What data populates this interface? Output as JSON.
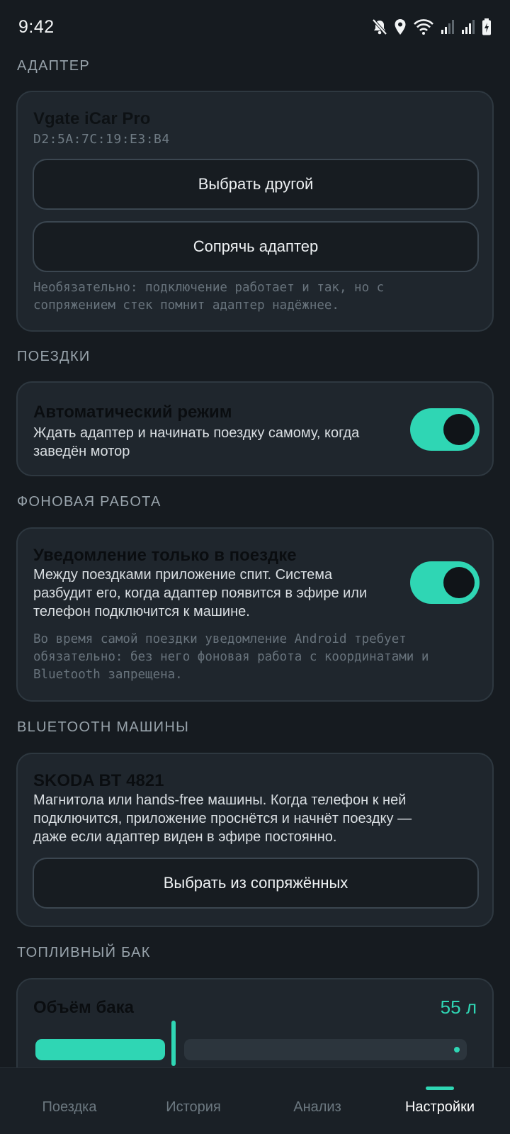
{
  "status_bar": {
    "time": "9:42",
    "icons": [
      "mute-icon",
      "location-icon",
      "wifi-icon",
      "signal-icon",
      "signal-icon",
      "battery-charging-icon"
    ]
  },
  "colors": {
    "accent": "#2fd6b4",
    "background": "#161b20",
    "card": "#1f262d"
  },
  "adapter": {
    "section_title": "АДАПТЕР",
    "name": "Vgate iCar Pro",
    "mac": "D2:5A:7C:19:E3:B4",
    "choose_other_label": "Выбрать другой",
    "pair_label": "Сопрячь адаптер",
    "hint_line1": "Необязательно: подключение работает и так, но с",
    "hint_line2": "сопряжением стек помнит адаптер надёжнее."
  },
  "trips": {
    "section_title": "ПОЕЗДКИ",
    "auto_mode_title": "Автоматический режим",
    "auto_mode_desc_line1": "Ждать адаптер и начинать поездку самому, когда",
    "auto_mode_desc_line2": "заведён мотор",
    "auto_mode_enabled": true
  },
  "background": {
    "section_title": "ФОНОВАЯ РАБОТА",
    "notification_title": "Уведомление только в поездке",
    "notification_desc_line1": "Между поездками приложение спит. Система",
    "notification_desc_line2": "разбудит его, когда адаптер появится в эфире или",
    "notification_desc_line3": "телефон подключится к машине.",
    "notification_enabled": true,
    "hint_line1": "Во время самой поездки уведомление Android требует",
    "hint_line2": "обязательно: без него фоновая работа с координатами и",
    "hint_line3": "Bluetooth запрещена."
  },
  "car_bluetooth": {
    "section_title": "BLUETOOTH МАШИНЫ",
    "device_name": "SKODA BT 4821",
    "desc_line1": "Магнитола или hands-free машины. Когда телефон к ней",
    "desc_line2": "подключится, приложение проснётся и начнёт поездку —",
    "desc_line3": "даже если адаптер виден в эфире постоянно.",
    "choose_paired_label": "Выбрать из сопряжённых"
  },
  "fuel_tank": {
    "section_title": "ТОПЛИВНЫЙ БАК",
    "volume_label": "Объём бака",
    "volume_value": "55 л",
    "slider_fraction": 0.32
  },
  "bottom_nav": {
    "items": [
      {
        "label": "Поездка"
      },
      {
        "label": "История"
      },
      {
        "label": "Анализ"
      },
      {
        "label": "Настройки"
      }
    ],
    "active_index": 3
  }
}
